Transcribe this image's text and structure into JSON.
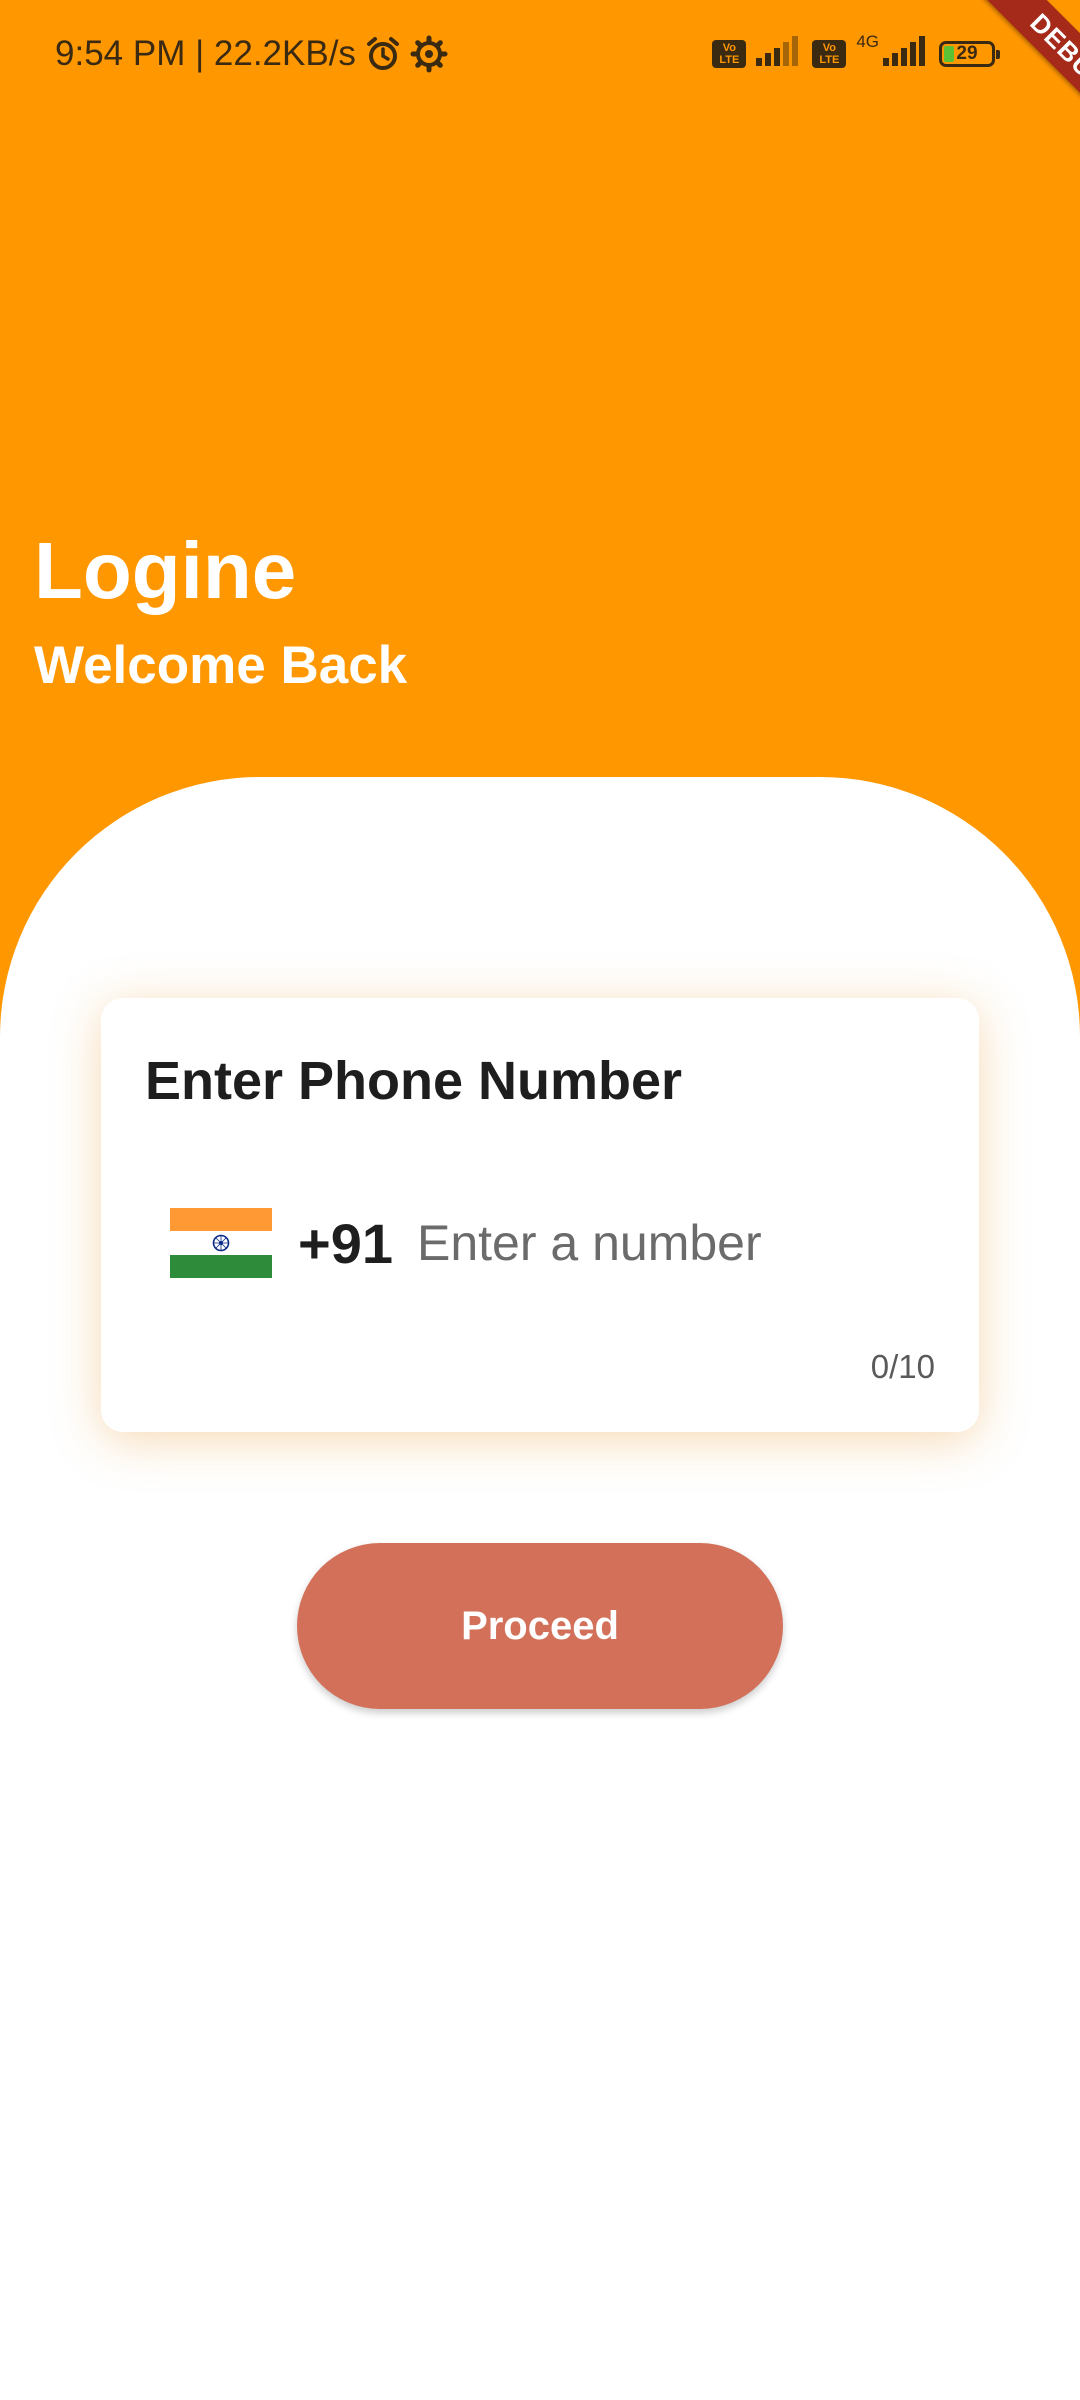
{
  "status_bar": {
    "time_speed": "9:54 PM | 22.2KB/s",
    "volte_1": "Vo\nLTE",
    "volte_2": "Vo\nLTE",
    "network_type": "4G",
    "battery_level": "29",
    "icons": [
      "alarm-icon",
      "settings-gear-icon",
      "signal-icon",
      "battery-icon"
    ]
  },
  "debug_banner": {
    "label": "DEBUG"
  },
  "header": {
    "title": "Logine",
    "subtitle": "Welcome Back",
    "background_color": "#ff9700"
  },
  "phone_card": {
    "title": "Enter Phone Number",
    "country_flag": "india-flag-icon",
    "dial_code": "+91",
    "input_value": "",
    "input_placeholder": "Enter a number",
    "counter": "0/10"
  },
  "actions": {
    "proceed_label": "Proceed",
    "proceed_color": "#d2705a"
  }
}
